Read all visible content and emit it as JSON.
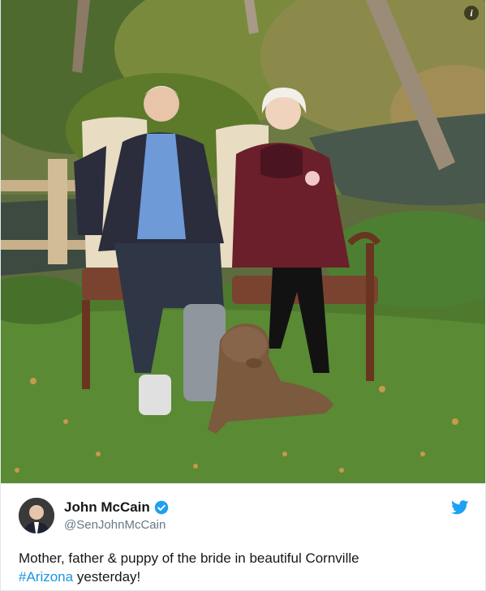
{
  "tweet": {
    "author": {
      "display_name": "John McCain",
      "handle": "@SenJohnMcCain",
      "verified": true,
      "avatar_icon": "profile-photo"
    },
    "text": {
      "line1": "Mother, father & puppy of the bride in beautiful Cornville",
      "hashtag": "#Arizona",
      "rest": " yesterday!"
    },
    "media": {
      "icon": "info-icon",
      "info_glyph": "i"
    },
    "brand_icon": "twitter-bird-icon"
  },
  "colors": {
    "link": "#1b95e0",
    "text": "#14171a",
    "secondary": "#657786",
    "twitter_blue": "#1da1f2",
    "border": "#e1e8ed"
  }
}
